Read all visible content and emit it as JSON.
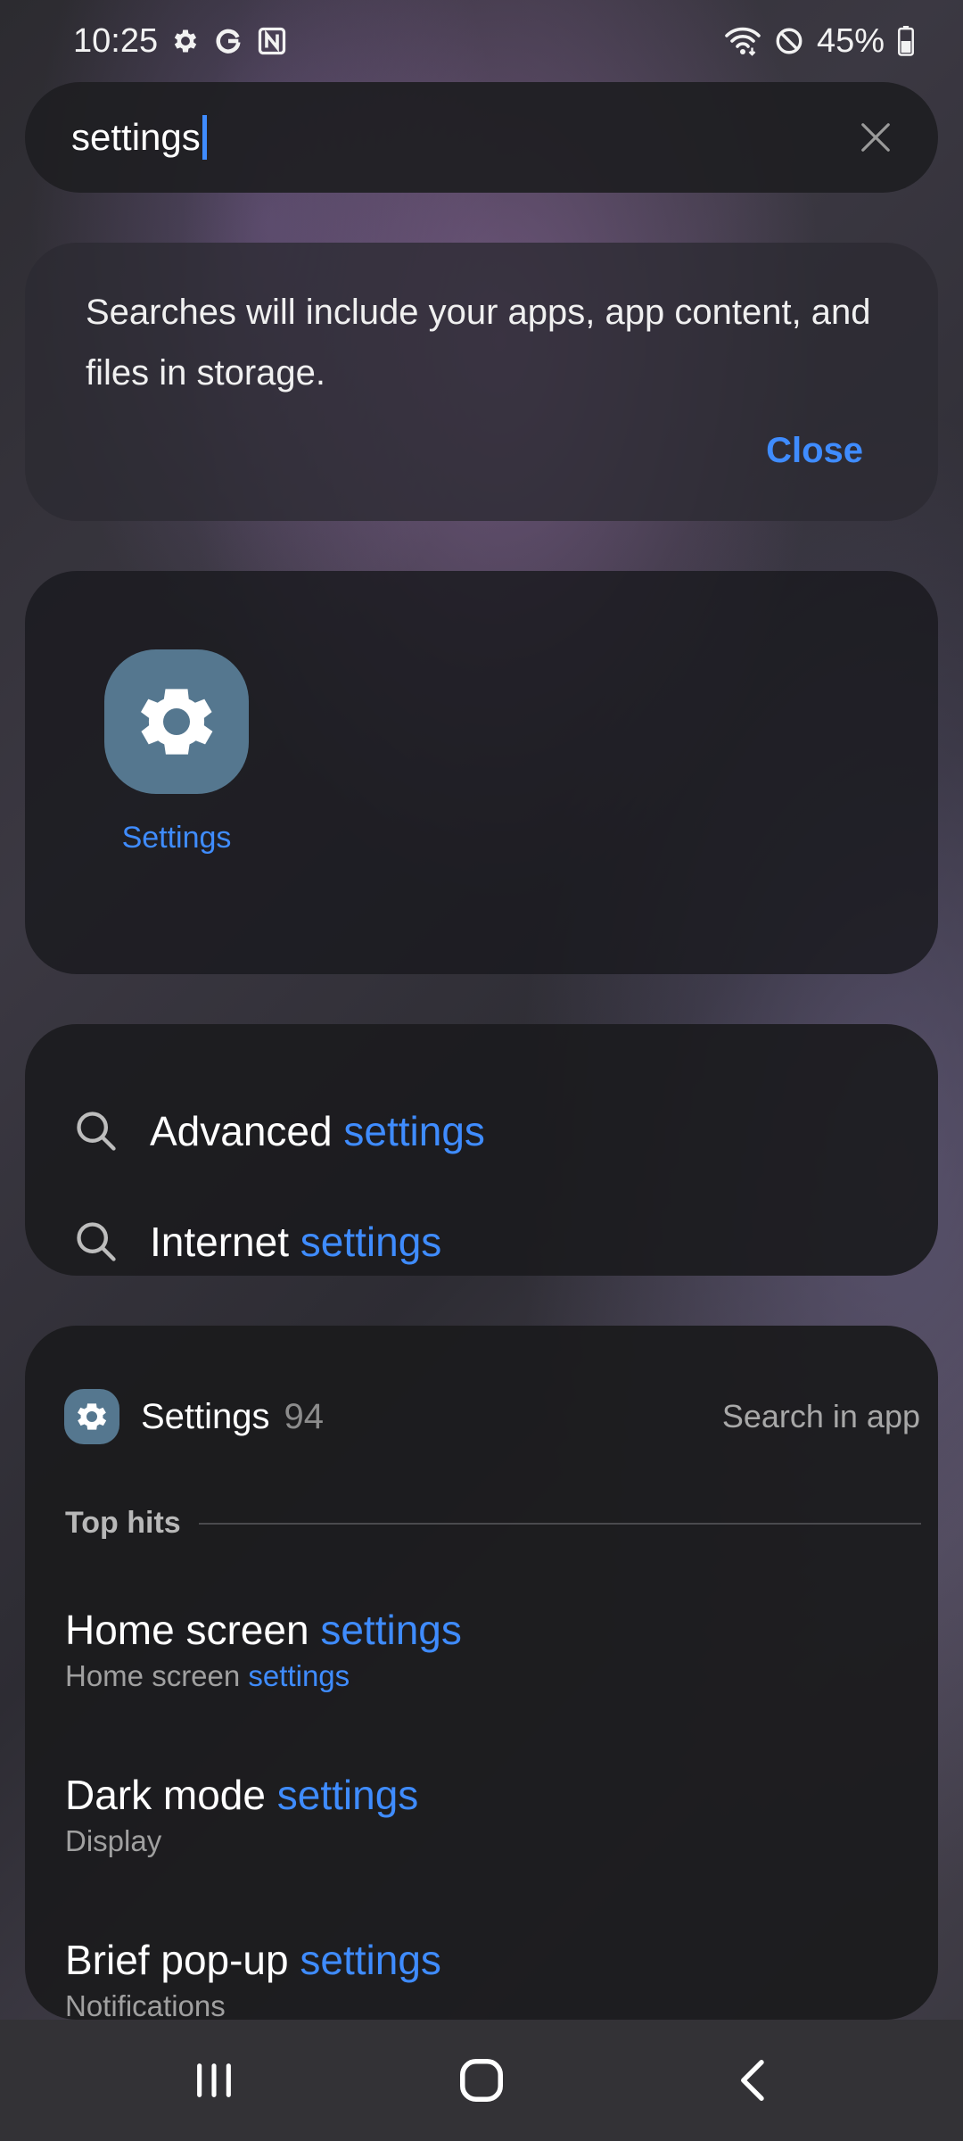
{
  "status_bar": {
    "time": "10:25",
    "left_icons": [
      "gear-icon",
      "google-icon",
      "notion-icon"
    ],
    "right_icons": [
      "wifi-icon",
      "do-not-disturb-icon"
    ],
    "battery": "45%"
  },
  "search": {
    "query": "settings",
    "clear_icon": "close-icon"
  },
  "info_card": {
    "message": "Searches will include your apps, app content, and files in storage.",
    "close_label": "Close"
  },
  "app_result": {
    "label": "Settings",
    "icon": "gear-icon"
  },
  "suggestions": [
    {
      "prefix": "Advanced ",
      "match": "settings",
      "icon": "search-icon"
    },
    {
      "prefix": "Internet ",
      "match": "settings",
      "icon": "search-icon"
    }
  ],
  "results": {
    "app_name": "Settings",
    "count": "94",
    "search_in_app": "Search in app",
    "section_label": "Top hits",
    "hits": [
      {
        "title_prefix": "Home screen ",
        "title_match": "settings",
        "sub_prefix": "Home screen ",
        "sub_match": "settings"
      },
      {
        "title_prefix": "Dark mode ",
        "title_match": "settings",
        "sub_prefix": "Display",
        "sub_match": ""
      },
      {
        "title_prefix": "Brief pop-up ",
        "title_match": "settings",
        "sub_prefix": "Notifications",
        "sub_match": ""
      }
    ]
  },
  "nav_bar": {
    "buttons": [
      "recents-icon",
      "home-icon",
      "back-icon"
    ]
  },
  "colors": {
    "accent": "#3f8cff",
    "app_icon": "#55778f"
  }
}
